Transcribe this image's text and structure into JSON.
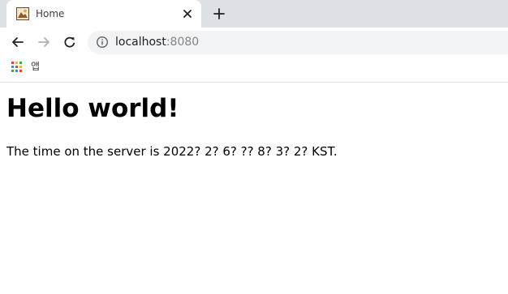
{
  "browser": {
    "tab": {
      "title": "Home"
    },
    "address_bar": {
      "host": "localhost",
      "port": ":8080"
    },
    "bookmarks_bar": {
      "apps_label": "앱"
    }
  },
  "page": {
    "heading": "Hello world!",
    "paragraph": "The time on the server is 2022? 2? 6? ?? 8? 3? 2? KST."
  }
}
